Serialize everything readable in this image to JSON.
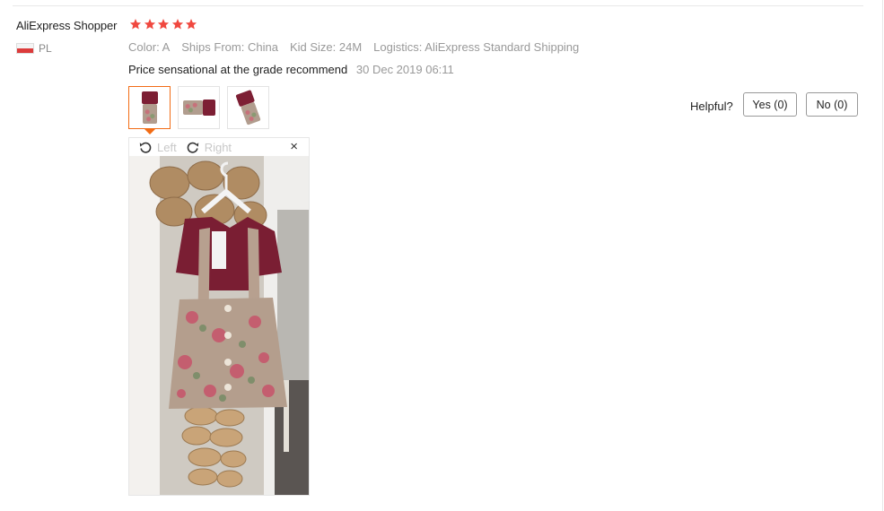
{
  "reviewer": {
    "name": "AliExpress Shopper",
    "country_code": "PL",
    "flag_icon": "poland-flag-icon",
    "rating_stars": 5,
    "star_color": "#f0483f"
  },
  "attributes": [
    {
      "key": "Color:",
      "value": "A"
    },
    {
      "key": "Ships From:",
      "value": "China"
    },
    {
      "key": "Kid Size:",
      "value": "24M"
    },
    {
      "key": "Logistics:",
      "value": "AliExpress Standard Shipping"
    }
  ],
  "review": {
    "text": "Price sensational at the grade recommend",
    "date": "30 Dec 2019 06:11"
  },
  "thumbnails": [
    {
      "name": "review-photo-1",
      "active": true
    },
    {
      "name": "review-photo-2",
      "active": false
    },
    {
      "name": "review-photo-3",
      "active": false
    }
  ],
  "viewer": {
    "rotate_left_label": "Left",
    "rotate_right_label": "Right",
    "close_label": "×"
  },
  "feedback": {
    "question": "Helpful?",
    "yes_label": "Yes (0)",
    "no_label": "No (0)"
  },
  "colors": {
    "accent": "#f26c15",
    "muted_text": "#999999"
  }
}
